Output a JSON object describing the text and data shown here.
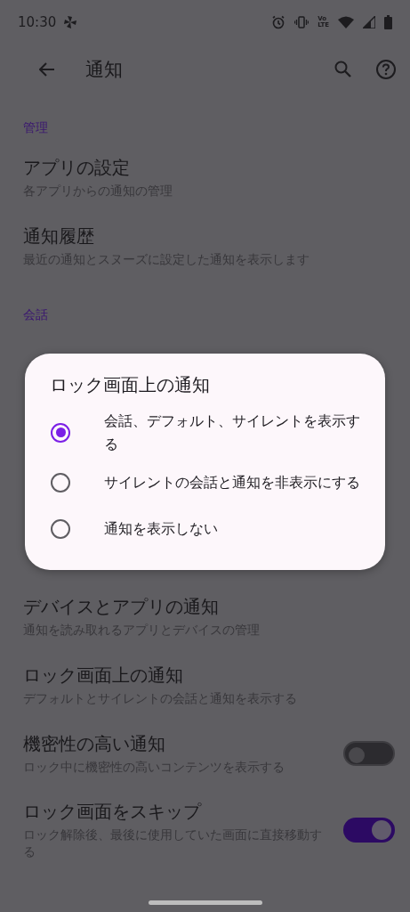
{
  "status_bar": {
    "time": "10:30",
    "volte_top": "Vo",
    "volte_bottom": "LTE"
  },
  "app_bar": {
    "title": "通知"
  },
  "groups": [
    [
      {
        "kind": "header",
        "title": "管理"
      },
      {
        "kind": "item",
        "title": "アプリの設定",
        "subtitle": "各アプリからの通知の管理"
      },
      {
        "kind": "item",
        "title": "通知履歴",
        "subtitle": "最近の通知とスヌーズに設定した通知を表示します"
      },
      {
        "kind": "header",
        "title": "会話"
      }
    ],
    [
      {
        "kind": "item",
        "title": "デバイスとアプリの通知",
        "subtitle": "通知を読み取れるアプリとデバイスの管理"
      },
      {
        "kind": "item",
        "title": "ロック画面上の通知",
        "subtitle": "デフォルトとサイレントの会話と通知を表示する"
      },
      {
        "kind": "toggle",
        "title": "機密性の高い通知",
        "subtitle": "ロック中に機密性の高いコンテンツを表示する",
        "on": false
      },
      {
        "kind": "toggle",
        "title": "ロック画面をスキップ",
        "subtitle": "ロック解除後、最後に使用していた画面に直接移動する",
        "on": true
      }
    ]
  ],
  "dialog": {
    "title": "ロック画面上の通知",
    "options": [
      {
        "label": "会話、デフォルト、サイレントを表示する",
        "selected": true
      },
      {
        "label": "サイレントの会話と通知を非表示にする",
        "selected": false
      },
      {
        "label": "通知を表示しない",
        "selected": false
      }
    ]
  }
}
